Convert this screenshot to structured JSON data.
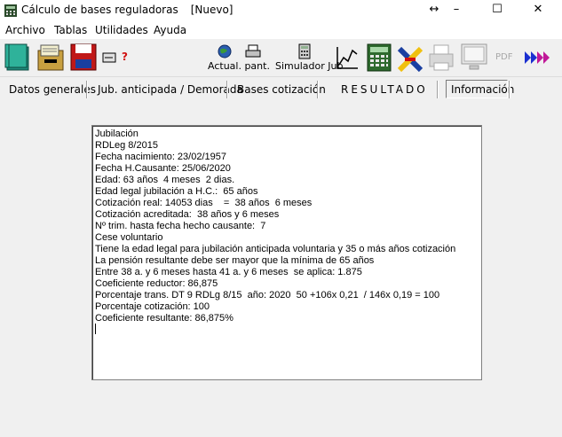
{
  "window": {
    "title": "Cálculo de bases reguladoras",
    "doc_state": "[Nuevo]",
    "controls": {
      "restore": "↔",
      "minimize": "–",
      "maximize": "☐",
      "close": "✕"
    }
  },
  "menu": [
    "Archivo",
    "Tablas",
    "Utilidades",
    "Ayuda"
  ],
  "toolbar": {
    "actual_label": "Actual. pant.",
    "simulador_label": "Simulador Jub",
    "pdf_label": "PDF",
    "help_mark": "?"
  },
  "tabs": [
    "Datos generales",
    "Jub. anticipada  / Demorada",
    "Bases cotización",
    "RESULTADO",
    "Información"
  ],
  "result": {
    "lines": [
      "Jubilación",
      "RDLeg 8/2015",
      "Fecha nacimiento: 23/02/1957",
      "Fecha H.Causante: 25/06/2020",
      "Edad: 63 años  4 meses  2 dias.",
      "Edad legal jubilación a H.C.:  65 años",
      "Cotización real: 14053 dias    =  38 años  6 meses",
      "Cotización acreditada:  38 años y 6 meses",
      "Nº trim. hasta fecha hecho causante:  7",
      "Cese voluntario",
      "Tiene la edad legal para jubilación anticipada voluntaria y 35 o más años cotización",
      "La pensión resultante debe ser mayor que la mínima de 65 años",
      "Entre 38 a. y 6 meses hasta 41 a. y 6 meses  se aplica: 1.875",
      "Coeficiente reductor: 86,875",
      "Porcentaje trans. DT 9 RDLg 8/15  año: 2020  50 +106x 0,21  / 146x 0,19 = 100",
      "Porcentaje cotización: 100",
      "Coeficiente resultante: 86,875%"
    ]
  }
}
